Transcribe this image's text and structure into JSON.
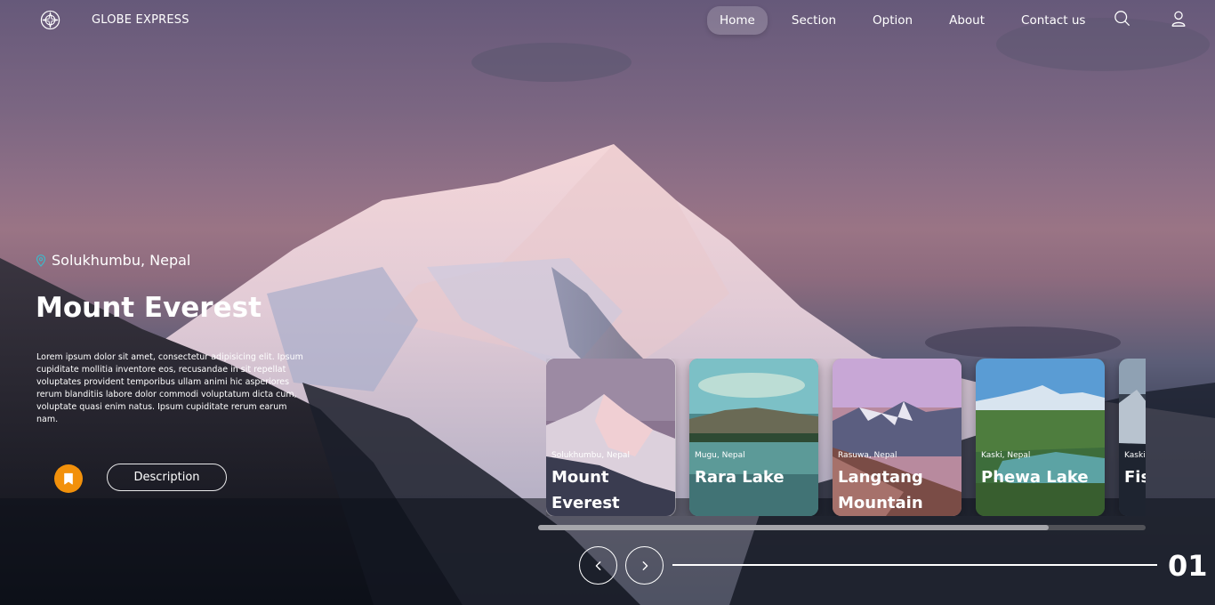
{
  "nav": {
    "brand": "GLOBE EXPRESS",
    "menu": [
      {
        "label": "Home",
        "active": true
      },
      {
        "label": "Section",
        "active": false
      },
      {
        "label": "Option",
        "active": false
      },
      {
        "label": "About",
        "active": false
      },
      {
        "label": "Contact us",
        "active": false
      }
    ],
    "icons": [
      "compass-logo-icon",
      "search-icon",
      "user-icon"
    ]
  },
  "hero": {
    "location": "Solukhumbu, Nepal",
    "title": "Mount Everest",
    "description": "Lorem ipsum dolor sit amet, consectetur adipisicing elit. Ipsum cupiditate mollitia inventore eos, recusandae in sit repellat voluptates provident temporibus ullam animi hic asperiores rerum blanditiis labore dolor commodi voluptatum dicta cum, voluptate quasi enim natus. Ipsum cupiditate rerum earum nam.",
    "description_button": "Description",
    "bookmark_icon": "bookmark-icon"
  },
  "cards": [
    {
      "location": "Solukhumbu, Nepal",
      "name": "Mount Everest"
    },
    {
      "location": "Mugu, Nepal",
      "name": "Rara Lake"
    },
    {
      "location": "Rasuwa, Nepal",
      "name": "Langtang Mountain"
    },
    {
      "location": "Kaski, Nepal",
      "name": "Phewa Lake"
    },
    {
      "location": "Kaski, Nepal",
      "name": "Fishtail"
    }
  ],
  "slider": {
    "current": "01",
    "scroll_progress": 0.84,
    "prev_icon": "chevron-left-icon",
    "next_icon": "chevron-right-icon"
  },
  "colors": {
    "accent": "#f2910b",
    "location_pin": "#3fb7c9"
  }
}
